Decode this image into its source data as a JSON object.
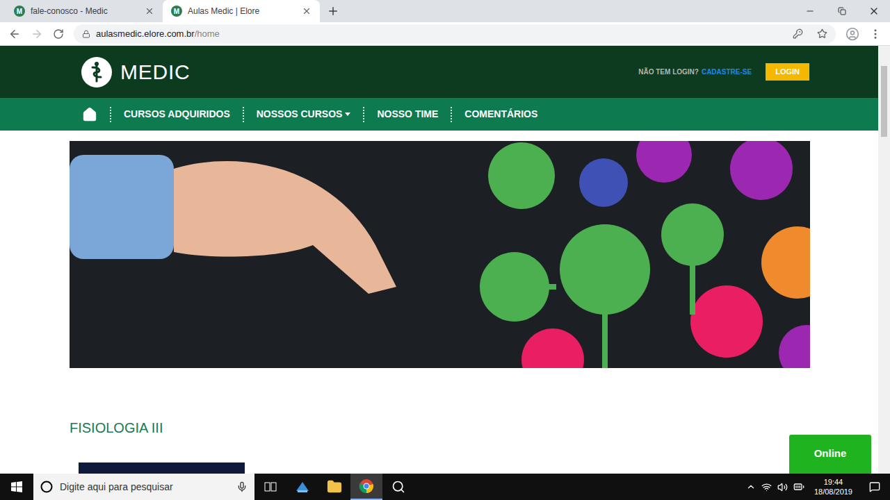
{
  "browser": {
    "tabs": [
      {
        "label": "fale-conosco - Medic",
        "favicon": "M",
        "selected": false
      },
      {
        "label": "Aulas Medic | Elore",
        "favicon": "M",
        "selected": true
      }
    ],
    "address": {
      "host": "aulasmedic.elore.com.br",
      "path": "/home"
    }
  },
  "header": {
    "logo": "MEDIC",
    "login_prompt": "NÃO TEM LOGIN?",
    "signup": "CADASTRE-SE",
    "login_button": "LOGIN"
  },
  "nav": {
    "items": [
      {
        "label": "CURSOS ADQUIRIDOS",
        "dropdown": false
      },
      {
        "label": "NOSSOS CURSOS",
        "dropdown": true
      },
      {
        "label": "NOSSO TIME",
        "dropdown": false
      },
      {
        "label": "COMENTÁRIOS",
        "dropdown": false
      }
    ]
  },
  "section": {
    "title": "FISIOLOGIA III"
  },
  "chat": {
    "label": "Online"
  },
  "taskbar": {
    "search_placeholder": "Digite aqui para pesquisar",
    "time": "19:44",
    "date": "18/08/2019"
  }
}
